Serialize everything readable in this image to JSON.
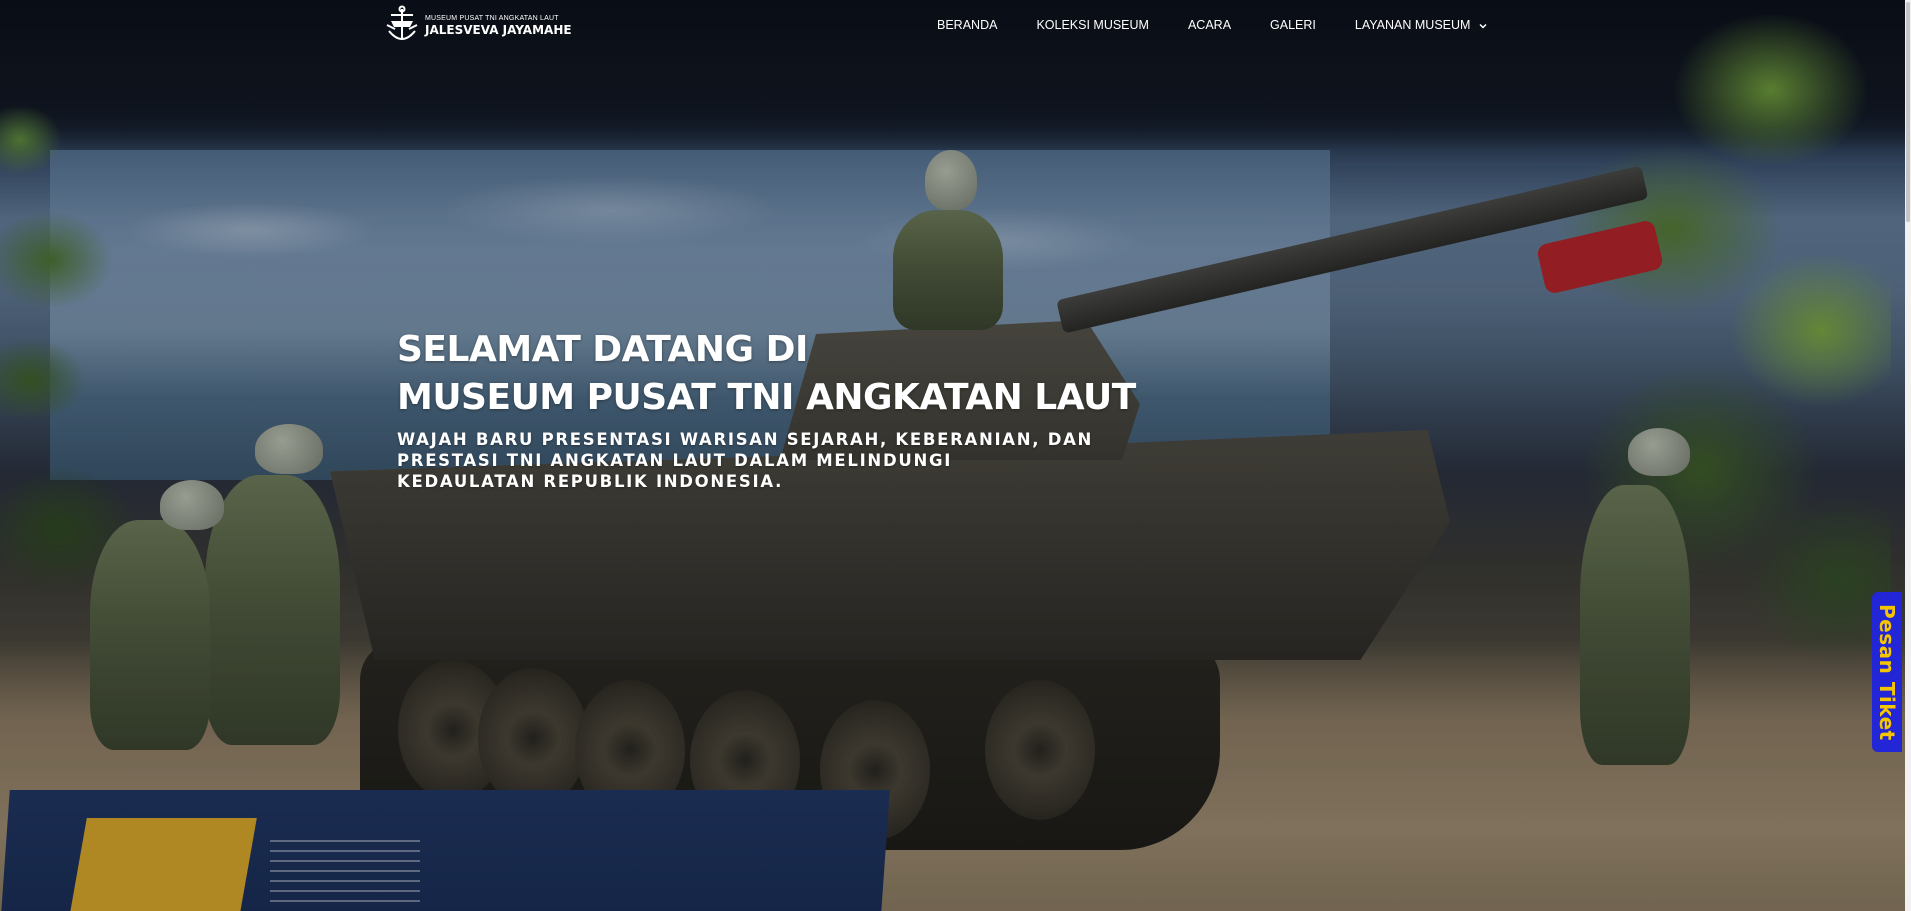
{
  "brand": {
    "tagline": "MUSEUM PUSAT TNI ANGKATAN LAUT",
    "name": "JALESVEVA JAYAMAHE"
  },
  "nav": {
    "items": [
      {
        "label": "BERANDA"
      },
      {
        "label": "KOLEKSI MUSEUM"
      },
      {
        "label": "ACARA"
      },
      {
        "label": "GALERI"
      },
      {
        "label": "LAYANAN MUSEUM",
        "has_dropdown": true,
        "icon": "chevron-down-icon"
      }
    ]
  },
  "hero": {
    "title_line1": "SELAMAT DATANG DI",
    "title_line2": "MUSEUM PUSAT TNI ANGKATAN LAUT",
    "subtitle": "WAJAH BARU PRESENTASI WARISAN SEJARAH, KEBERANIAN, DAN PRESTASI TNI ANGKATAN LAUT DALAM MELINDUNGI KEDAULATAN REPUBLIK INDONESIA."
  },
  "ticket": {
    "label": "Pesan Tiket"
  },
  "colors": {
    "ticket_bg": "#2226d6",
    "ticket_text": "#f5c600",
    "nav_text": "#ffffff"
  }
}
